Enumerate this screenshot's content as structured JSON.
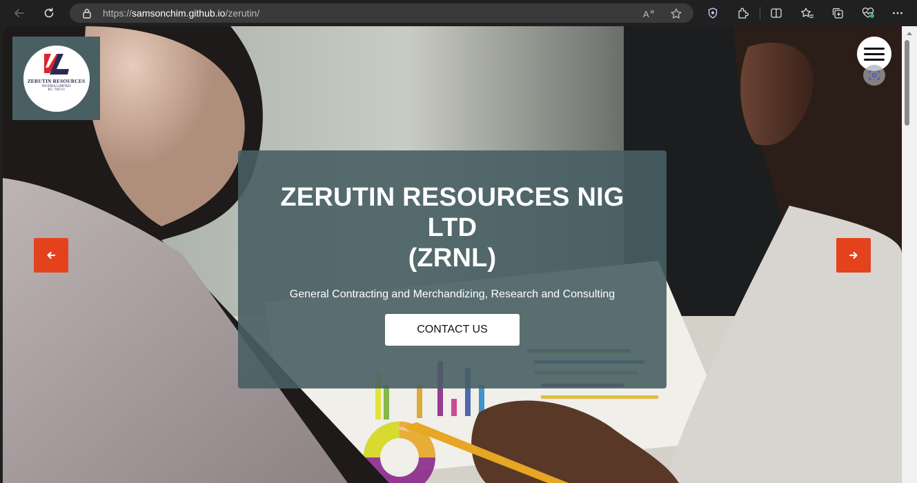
{
  "browser": {
    "url_prefix": "https://",
    "url_host": "samsonchim.github.io",
    "url_path": "/zerutin/",
    "icons": [
      "back-icon",
      "refresh-icon",
      "lock-icon",
      "read-aloud-icon",
      "favorite-star-icon",
      "shield-icon",
      "extensions-icon",
      "split-screen-icon",
      "favorites-icon",
      "collections-icon",
      "browser-essentials-icon",
      "more-icon"
    ]
  },
  "logo": {
    "line1": "ZERUTIN RESOURCES",
    "line2": "NIGERIA LIMITED",
    "line3": "RC: 766713",
    "colors": {
      "mark_red": "#d9262c",
      "mark_navy": "#2a2a55",
      "background": "#4a5f64"
    }
  },
  "hero": {
    "title_line1": "ZERUTIN RESOURCES NIG",
    "title_line2": "LTD",
    "title_line3": "(ZRNL)",
    "subtitle": "General Contracting and Merchandizing, Research and Consulting",
    "cta_label": "CONTACT US",
    "prev_icon": "arrow-left-icon",
    "next_icon": "arrow-right-icon",
    "accent": "#e4421c"
  },
  "menu": {
    "icon": "hamburger-icon"
  }
}
